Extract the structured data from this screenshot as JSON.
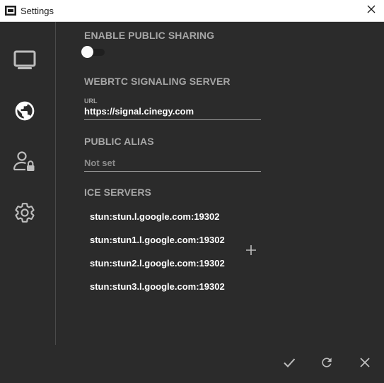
{
  "window": {
    "title": "Settings"
  },
  "sections": {
    "sharing": {
      "title": "ENABLE PUBLIC SHARING",
      "enabled": false
    },
    "signaling": {
      "title": "WEBRTC SIGNALING SERVER",
      "url_label": "URL",
      "url_value": "https://signal.cinegy.com"
    },
    "alias": {
      "title": "PUBLIC ALIAS",
      "placeholder": "Not set"
    },
    "ice": {
      "title": "ICE SERVERS",
      "servers": [
        "stun:stun.l.google.com:19302",
        "stun:stun1.l.google.com:19302",
        "stun:stun2.l.google.com:19302",
        "stun:stun3.l.google.com:19302"
      ]
    }
  },
  "sidebar": {
    "items": [
      {
        "icon": "monitor-icon"
      },
      {
        "icon": "globe-icon"
      },
      {
        "icon": "user-lock-icon"
      },
      {
        "icon": "gear-icon"
      }
    ]
  },
  "colors": {
    "background": "#2b2b2b",
    "section_title": "#a6a6a6",
    "text": "#ffffff",
    "icon": "#bdbdbd"
  }
}
